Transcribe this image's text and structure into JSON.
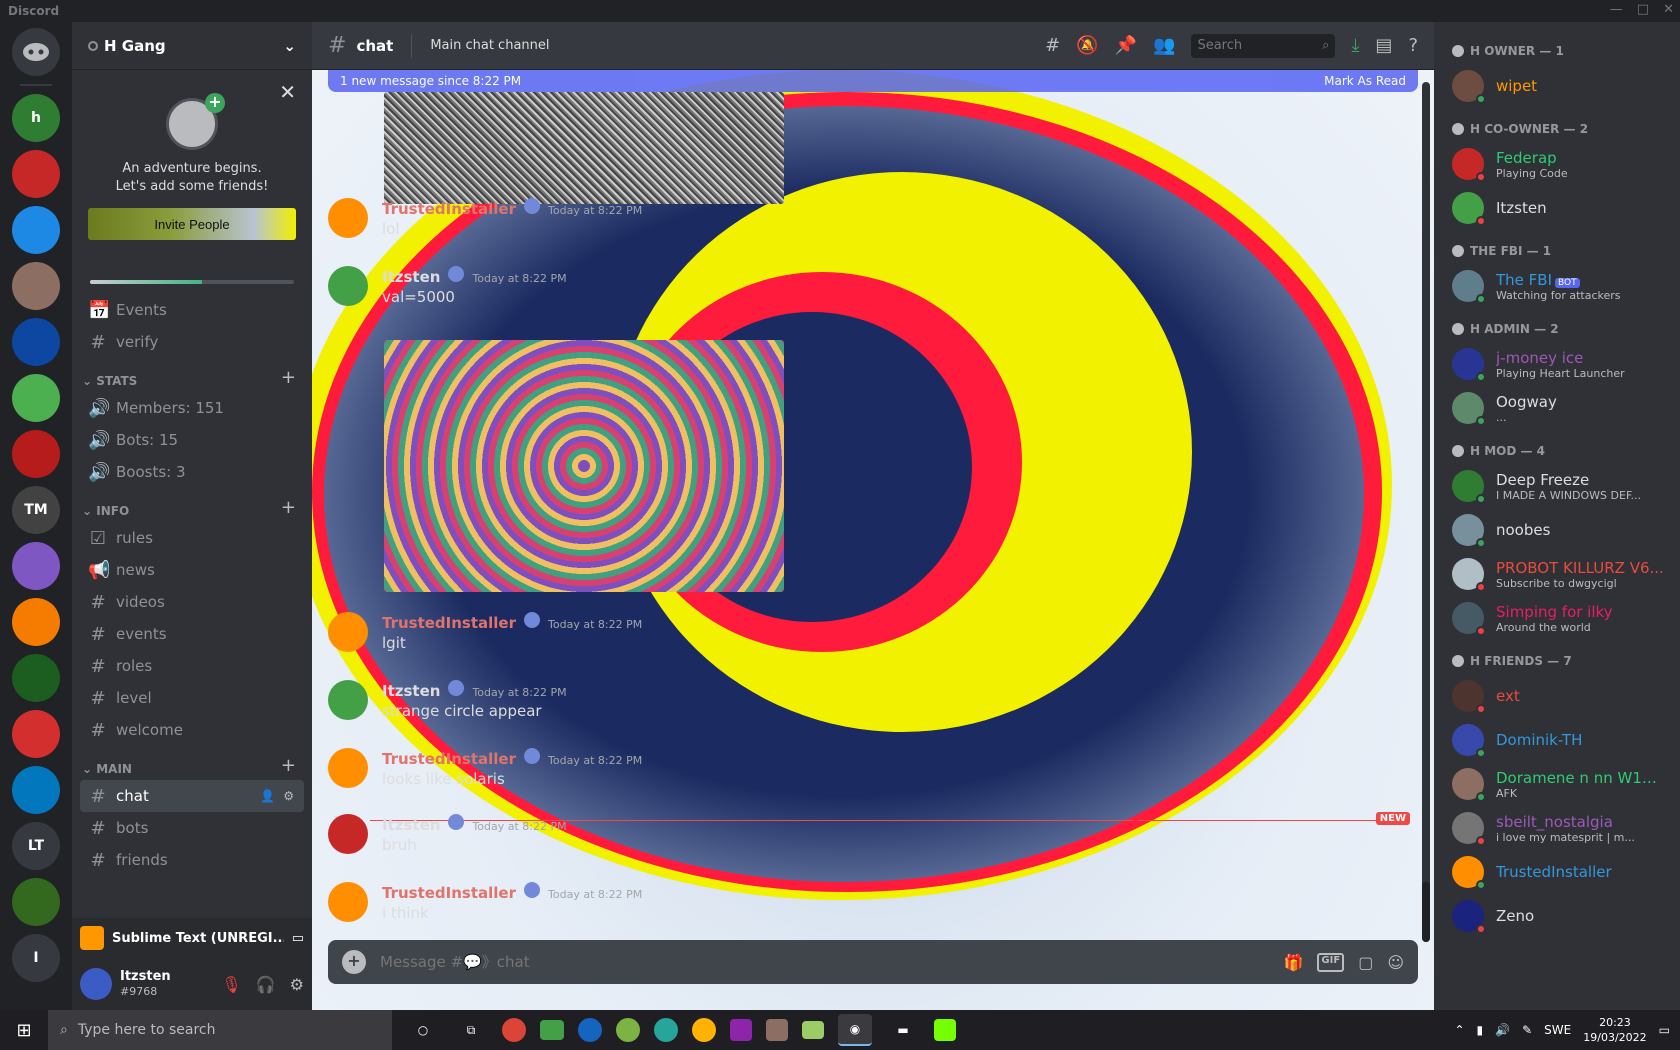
{
  "window": {
    "title": "Discord"
  },
  "server": {
    "name": "H Gang",
    "invite_card": {
      "line1": "An adventure begins.",
      "line2": "Let's add some friends!",
      "button": "Invite People",
      "progress_fraction": 0.55
    },
    "channels_top": [
      {
        "label": "Events",
        "icon": "calendar-icon",
        "type": "events"
      },
      {
        "label": "verify",
        "icon": "hash-icon",
        "type": "text"
      }
    ],
    "categories": [
      {
        "name": "STATS",
        "channels": [
          {
            "label": "Members: 151",
            "type": "voice"
          },
          {
            "label": "Bots: 15",
            "type": "voice"
          },
          {
            "label": "Boosts: 3",
            "type": "voice"
          }
        ]
      },
      {
        "name": "INFO",
        "channels": [
          {
            "label": "rules",
            "type": "rules"
          },
          {
            "label": "news",
            "type": "announce"
          },
          {
            "label": "videos",
            "type": "text"
          },
          {
            "label": "events",
            "type": "text"
          },
          {
            "label": "roles",
            "type": "text"
          },
          {
            "label": "level",
            "type": "text"
          },
          {
            "label": "welcome",
            "type": "text"
          }
        ]
      },
      {
        "name": "MAIN",
        "channels": [
          {
            "label": "chat",
            "type": "text",
            "active": true
          },
          {
            "label": "bots",
            "type": "text"
          },
          {
            "label": "friends",
            "type": "text"
          }
        ]
      }
    ],
    "activity": "Sublime Text (UNREGI...",
    "user": {
      "name": "Itzsten",
      "discriminator": "#9768"
    }
  },
  "guilds": [
    {
      "label": "h",
      "color": "#2e7d32"
    },
    {
      "label": "",
      "color": "#c62828"
    },
    {
      "label": "",
      "color": "#1e88e5"
    },
    {
      "label": "",
      "color": "#8d6e63"
    },
    {
      "label": "",
      "color": "#0d47a1"
    },
    {
      "label": "",
      "color": "#4caf50"
    },
    {
      "label": "",
      "color": "#b71c1c"
    },
    {
      "label": "TM",
      "color": "#424242"
    },
    {
      "label": "",
      "color": "#7e57c2"
    },
    {
      "label": "",
      "color": "#f57c00"
    },
    {
      "label": "",
      "color": "#1b5e20"
    },
    {
      "label": "",
      "color": "#d32f2f"
    },
    {
      "label": "",
      "color": "#0277bd"
    },
    {
      "label": "LT",
      "color": "#36393f"
    },
    {
      "label": "",
      "color": "#33691e"
    },
    {
      "label": "I",
      "color": "#36393f"
    }
  ],
  "new_badge": "NEW",
  "chat": {
    "channel_name": "chat",
    "topic": "Main chat channel",
    "search_placeholder": "Search",
    "new_messages_bar": "1 new message since 8:22 PM",
    "mark_as_read": "Mark As Read",
    "new_divider": "NEW",
    "composer_placeholder": "Message #💬》chat",
    "gif_label": "GIF",
    "messages": [
      {
        "author": "TrustedInstaller",
        "color": "#e0736b",
        "avatar": "#ff8f00",
        "time": "Today at 8:22 PM",
        "text": "lol"
      },
      {
        "author": "Itzsten",
        "color": "#dcddde",
        "avatar": "#43a047",
        "time": "Today at 8:22 PM",
        "text": "val=5000"
      },
      {
        "author": "TrustedInstaller",
        "color": "#e0736b",
        "avatar": "#ff8f00",
        "time": "Today at 8:22 PM",
        "text": "lgit"
      },
      {
        "author": "Itzsten",
        "color": "#dcddde",
        "avatar": "#43a047",
        "time": "Today at 8:22 PM",
        "text": "strange circle appear"
      },
      {
        "author": "TrustedInstaller",
        "color": "#e0736b",
        "avatar": "#ff8f00",
        "time": "Today at 8:22 PM",
        "text": "looks like solaris"
      },
      {
        "author": "Itzsten",
        "color": "#dcddde",
        "avatar": "#c62828",
        "time": "Today at 8:22 PM",
        "text": "bruh"
      },
      {
        "author": "TrustedInstaller",
        "color": "#e0736b",
        "avatar": "#ff8f00",
        "time": "Today at 8:22 PM",
        "text": "i think"
      }
    ]
  },
  "members": {
    "groups": [
      {
        "title": "H OWNER — 1",
        "members": [
          {
            "name": "wipet",
            "color": "#ff9800",
            "avatar": "#6d4c41",
            "status": "#3ba55d",
            "activity": ""
          }
        ]
      },
      {
        "title": "H CO-OWNER — 2",
        "members": [
          {
            "name": "Federap",
            "color": "#2ecc71",
            "avatar": "#c62828",
            "status": "#ed4245",
            "activity": "Playing Code"
          },
          {
            "name": "Itzsten",
            "color": "#dcddde",
            "avatar": "#43a047",
            "status": "#ed4245",
            "activity": ""
          }
        ]
      },
      {
        "title": "THE FBI — 1",
        "members": [
          {
            "name": "The FBI",
            "color": "#3498db",
            "avatar": "#607d8b",
            "status": "#3ba55d",
            "activity": "Watching for attackers",
            "bot": "BOT"
          }
        ]
      },
      {
        "title": "H ADMIN — 2",
        "members": [
          {
            "name": "j-money ice",
            "color": "#9b59b6",
            "avatar": "#283593",
            "status": "#3ba55d",
            "activity": "Playing Heart Launcher"
          },
          {
            "name": "Oogway",
            "color": "#dcddde",
            "avatar": "#5d8a6b",
            "status": "#3ba55d",
            "activity": "..."
          }
        ]
      },
      {
        "title": "H MOD — 4",
        "members": [
          {
            "name": "Deep Freeze",
            "color": "#dcddde",
            "avatar": "#2e7d32",
            "status": "#3ba55d",
            "activity": "I MADE A WINDOWS DEF..."
          },
          {
            "name": "noobes",
            "color": "#dcddde",
            "avatar": "#78909c",
            "status": "#3ba55d",
            "activity": ""
          },
          {
            "name": "PROBOT KILLURZ V6...",
            "color": "#e74c3c",
            "avatar": "#b0bec5",
            "status": "#ed4245",
            "activity": "Subscribe to dwgycigl"
          },
          {
            "name": "Simping for ilky",
            "color": "#e91e63",
            "avatar": "#455a64",
            "status": "#ed4245",
            "activity": "Around the world"
          }
        ]
      },
      {
        "title": "H FRIENDS — 7",
        "members": [
          {
            "name": "ext",
            "color": "#e74c3c",
            "avatar": "#4e342e",
            "status": "#ed4245",
            "activity": ""
          },
          {
            "name": "Dominik-TH",
            "color": "#3498db",
            "avatar": "#3949ab",
            "status": "#3ba55d",
            "activity": ""
          },
          {
            "name": "Doramene n nn W11 U...",
            "color": "#2ecc71",
            "avatar": "#8d6e63",
            "status": "#3ba55d",
            "activity": "AFK"
          },
          {
            "name": "sbeilt_nostalgia",
            "color": "#9b59b6",
            "avatar": "#757575",
            "status": "#ed4245",
            "activity": "i love my matesprit | m..."
          },
          {
            "name": "TrustedInstaller",
            "color": "#3498db",
            "avatar": "#ff8f00",
            "status": "#3ba55d",
            "activity": ""
          },
          {
            "name": "Zeno",
            "color": "#dcddde",
            "avatar": "#1a237e",
            "status": "#ed4245",
            "activity": ""
          }
        ]
      }
    ]
  },
  "taskbar": {
    "search_placeholder": "Type here to search",
    "language": "SWE",
    "time": "20:23",
    "date": "19/03/2022"
  }
}
